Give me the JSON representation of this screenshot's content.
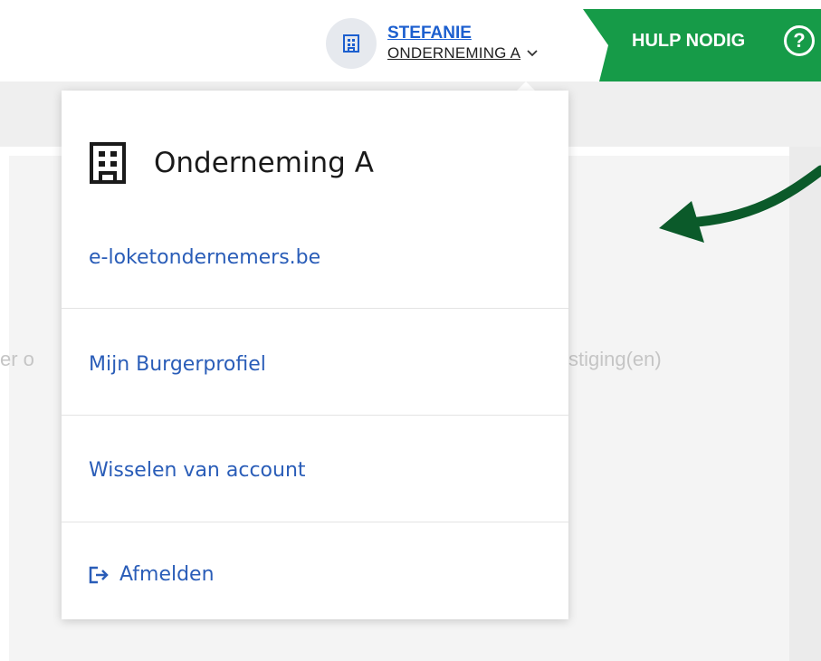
{
  "header": {
    "user_name": "STEFANIE",
    "organization": "ONDERNEMING A",
    "help_label": "HULP NODIG",
    "help_icon_glyph": "?"
  },
  "background": {
    "text_left": "er o",
    "text_right": "stiging(en)"
  },
  "menu": {
    "org_title": "Onderneming A",
    "org_icon": "building-icon",
    "items": [
      {
        "label": "e-loketondernemers.be"
      },
      {
        "label": "Mijn Burgerprofiel"
      },
      {
        "label": "Wisselen van account"
      }
    ],
    "logout_label": "Afmelden",
    "logout_icon": "logout-icon"
  },
  "colors": {
    "accent_green": "#169b48",
    "link_blue": "#2a5db8",
    "arrow_green": "#0b5a2a"
  }
}
